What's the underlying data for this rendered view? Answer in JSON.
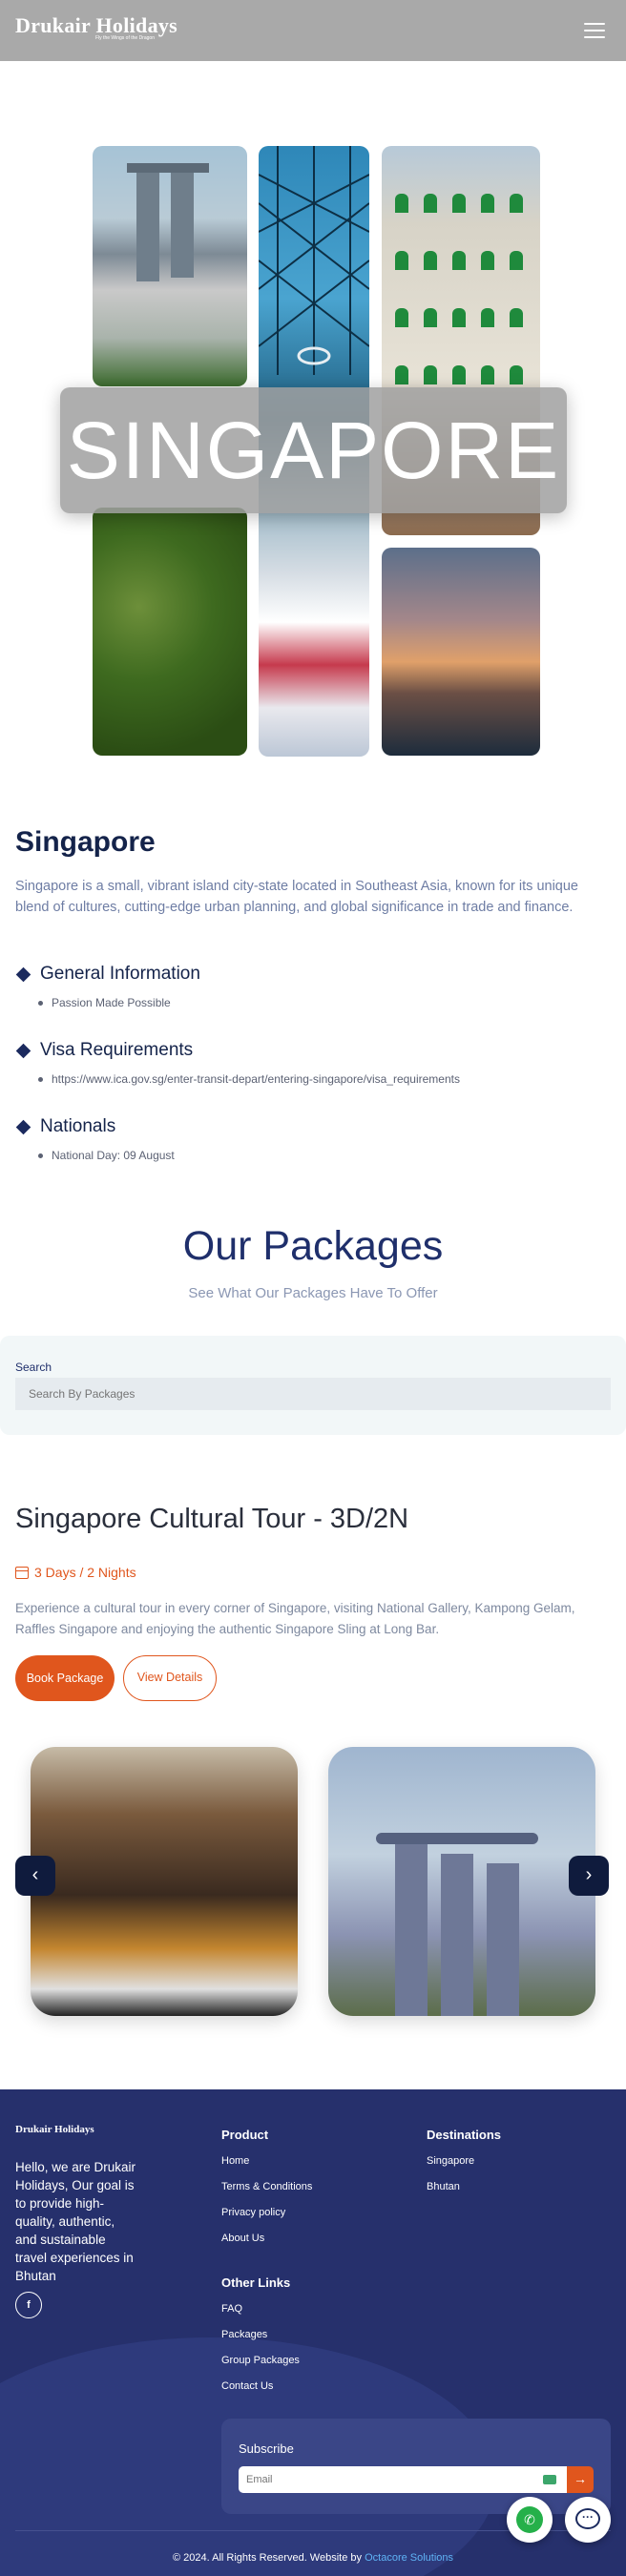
{
  "header": {
    "logo": "Drukair Holidays",
    "tagline": "Fly the Wings of the Dragon",
    "menu_icon": "hamburger-icon"
  },
  "hero": {
    "title": "SINGAPORE"
  },
  "intro": {
    "heading": "Singapore",
    "text": "Singapore is a small, vibrant island city-state located in Southeast Asia, known for its unique blend of cultures, cutting-edge urban planning, and global significance in trade and finance."
  },
  "info": [
    {
      "title": "General Information",
      "items": [
        "Passion Made Possible"
      ]
    },
    {
      "title": "Visa Requirements",
      "items": [
        "https://www.ica.gov.sg/enter-transit-depart/entering-singapore/visa_requirements"
      ]
    },
    {
      "title": "Nationals",
      "items": [
        "National Day: 09 August"
      ]
    }
  ],
  "packages": {
    "title": "Our Packages",
    "subtitle": "See What Our Packages Have To Offer",
    "search_label": "Search",
    "search_placeholder": "Search By Packages"
  },
  "tour": {
    "title": "Singapore Cultural Tour - 3D/2N",
    "duration": "3 Days / 2 Nights",
    "description": "Experience a cultural tour in every corner of Singapore, visiting National Gallery, Kampong Gelam, Raffles Singapore and enjoying the authentic Singapore Sling at Long Bar.",
    "book_label": "Book Package",
    "view_label": "View Details",
    "prev_icon": "chevron-left-icon",
    "next_icon": "chevron-right-icon",
    "prev_glyph": "‹",
    "next_glyph": "›"
  },
  "footer": {
    "logo": "Drukair Holidays",
    "about": "Hello, we are Drukair Holidays, Our goal is to provide high-quality, authentic, and sustainable travel experiences in Bhutan",
    "social": "f",
    "product_head": "Product",
    "product_links": [
      "Home",
      "Terms & Conditions",
      "Privacy policy",
      "About Us"
    ],
    "destinations_head": "Destinations",
    "destinations_links": [
      "Singapore",
      "Bhutan"
    ],
    "other_head": "Other Links",
    "other_links": [
      "FAQ",
      "Packages",
      "Group Packages",
      "Contact Us"
    ],
    "subscribe_title": "Subscribe",
    "email_placeholder": "Email",
    "copyright": "© 2024. All Rights Reserved. Website by",
    "credit": "Octacore Solutions"
  },
  "floating": {
    "whatsapp_glyph": "✆",
    "chat_glyph": "···"
  }
}
